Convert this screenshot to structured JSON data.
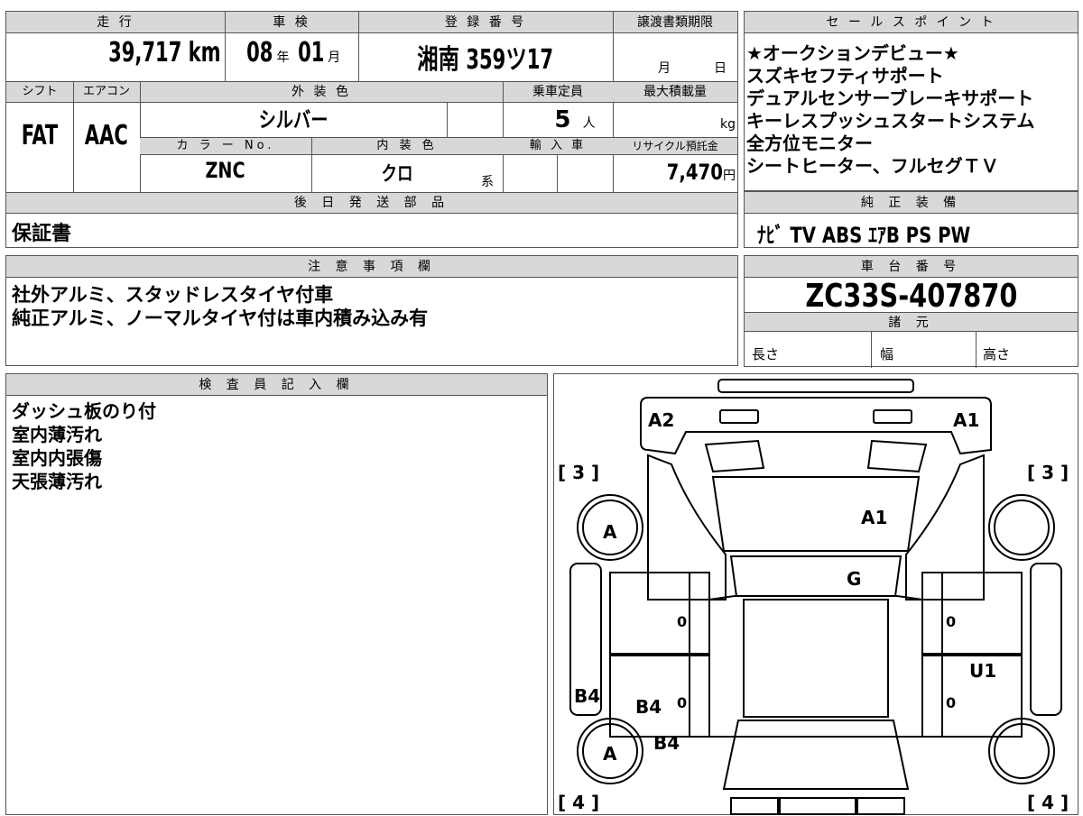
{
  "top_header": {
    "mileage_label": "走 行",
    "inspection_label": "車 検",
    "registration_label": "登 録 番 号",
    "transfer_deadline_label": "譲渡書類期限",
    "sales_points_label": "セ ー ル ス ポ イ ン ト"
  },
  "vehicle": {
    "mileage": "39,717 km",
    "inspection_year": "08",
    "inspection_year_unit": "年",
    "inspection_month": "01",
    "inspection_month_unit": "月",
    "registration": "湘南 359ツ17",
    "deadline_month_unit": "月",
    "deadline_day_unit": "日",
    "shift_label": "シフト",
    "shift": "FAT",
    "aircon_label": "エアコン",
    "aircon": "AAC",
    "exterior_color_label": "外 装 色",
    "exterior_color": "シルバー",
    "capacity_label": "乗車定員",
    "capacity": "5",
    "capacity_unit": "人",
    "max_load_label": "最大積載量",
    "max_load_unit": "kg",
    "color_no_label": "カ ラ ー No.",
    "color_no": "ZNC",
    "interior_color_label": "内 装 色",
    "interior_color": "クロ",
    "interior_color_suffix": "系",
    "import_label": "輸 入 車",
    "recycle_label": "リサイクル預託金",
    "recycle_fee": "7,470",
    "recycle_unit": "円"
  },
  "later_parts": {
    "label": "後 日 発 送 部 品",
    "value": "保証書"
  },
  "sales_points": [
    "★オークションデビュー★",
    "スズキセフティサポート",
    "デュアルセンサーブレーキサポート",
    "キーレスプッシュスタートシステム",
    "全方位モニター",
    "シートヒーター、フルセグＴＶ"
  ],
  "genuine_equipment": {
    "label": "純 正 装 備",
    "value": "ﾅﾋﾞ TV ABS ｴｱB PS PW"
  },
  "notes": {
    "label": "注 意 事 項 欄",
    "lines": [
      "社外アルミ、スタッドレスタイヤ付車",
      "純正アルミ、ノーマルタイヤ付は車内積み込み有"
    ]
  },
  "chassis": {
    "label": "車 台 番 号",
    "value": "ZC33S-407870"
  },
  "specs": {
    "label": "諸 元",
    "length": "長さ",
    "width": "幅",
    "height": "高さ"
  },
  "inspector": {
    "label": "検 査 員 記 入 欄",
    "lines": [
      "ダッシュ板のり付",
      "室内薄汚れ",
      "室内内張傷",
      "天張薄汚れ"
    ]
  },
  "diagram": {
    "marks": [
      "A2",
      "A1",
      "A1",
      "G",
      "U1",
      "B4",
      "B4",
      "B4",
      "A",
      "A",
      "0",
      "0",
      "0",
      "0"
    ],
    "brackets": [
      "[ 3 ]",
      "[ 3 ]",
      "[ 4 ]",
      "[ 4 ]"
    ]
  }
}
